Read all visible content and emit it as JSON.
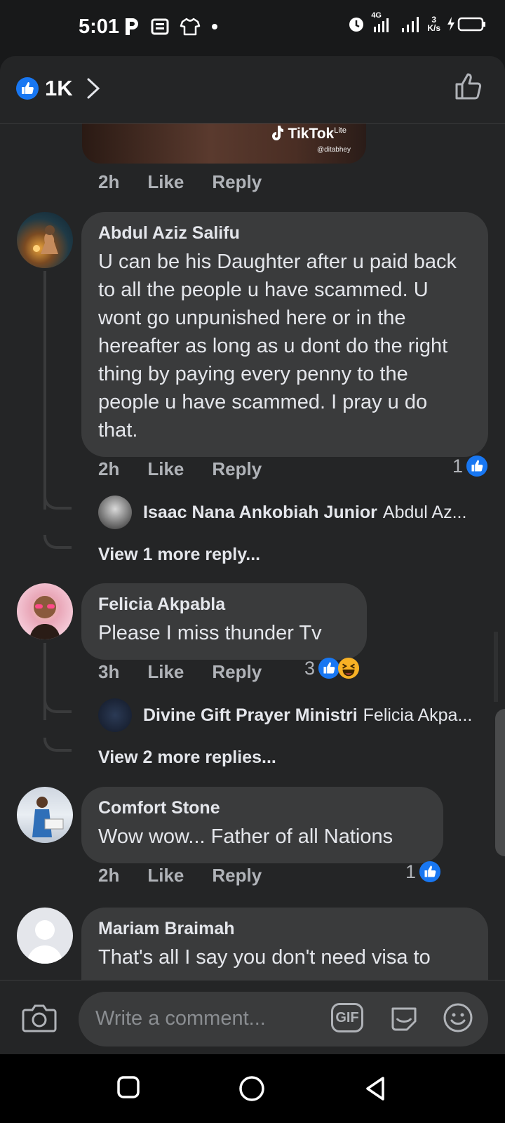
{
  "status_bar": {
    "time": "5:01",
    "network": "4G",
    "speed_value": "3",
    "speed_unit": "K/s"
  },
  "header": {
    "like_count": "1K"
  },
  "media": {
    "brand": "TikTok",
    "brand_suffix": "Lite",
    "handle": "@ditabhey"
  },
  "media_meta": {
    "time": "2h",
    "like_label": "Like",
    "reply_label": "Reply"
  },
  "comments": [
    {
      "name": "Abdul Aziz Salifu",
      "text": "U can be his Daughter after u paid back to all the people u have scammed. U wont go unpunished here or in the hereafter as long as u dont do the right thing by paying every penny to the people u have scammed. I pray u do that.",
      "time": "2h",
      "like_label": "Like",
      "reply_label": "Reply",
      "reaction_count": "1",
      "reply_preview": {
        "name": "Isaac Nana Ankobiah Junior",
        "text": "Abdul Az..."
      },
      "view_more": "View 1 more reply..."
    },
    {
      "name": "Felicia Akpabla",
      "text": "Please I miss thunder Tv",
      "time": "3h",
      "like_label": "Like",
      "reply_label": "Reply",
      "reaction_count": "3",
      "reply_preview": {
        "name": "Divine Gift Prayer Ministri",
        "text": "Felicia Akpa..."
      },
      "view_more": "View 2 more replies..."
    },
    {
      "name": "Comfort Stone",
      "text": "Wow wow... Father of all Nations",
      "time": "2h",
      "like_label": "Like",
      "reply_label": "Reply",
      "reaction_count": "1"
    },
    {
      "name": "Mariam Braimah",
      "text": "That's all I say you don't need visa to"
    }
  ],
  "composer": {
    "placeholder": "Write a comment...",
    "gif_label": "GIF"
  },
  "colors": {
    "like_blue": "#1877f2",
    "bubble": "#3a3b3c",
    "sheet": "#242526"
  }
}
